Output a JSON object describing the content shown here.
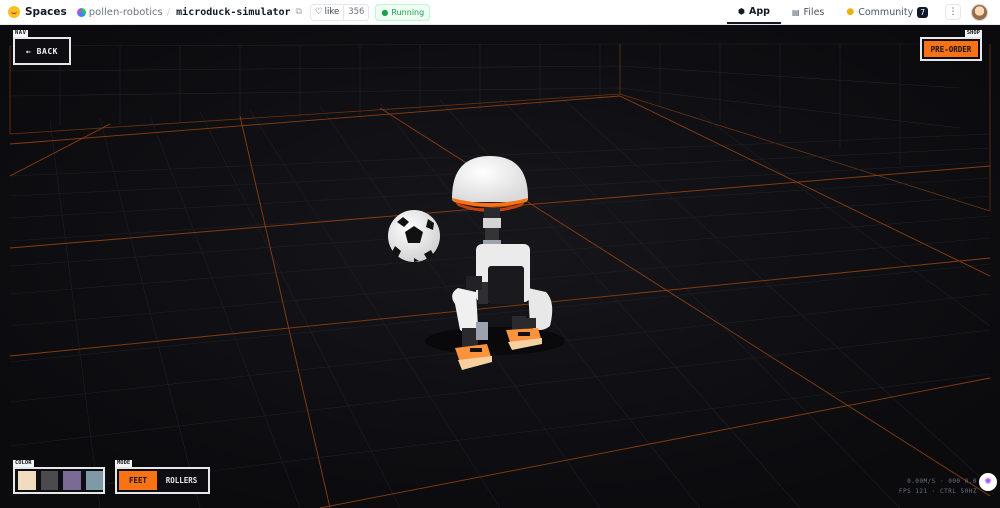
{
  "topbar": {
    "brand": "Spaces",
    "owner": "pollen-robotics",
    "separator": "/",
    "repo": "microduck-simulator",
    "like_label": "like",
    "like_count": "356",
    "status": "Running",
    "tabs": [
      {
        "label": "App",
        "active": true
      },
      {
        "label": "Files",
        "active": false
      },
      {
        "label": "Community",
        "active": false,
        "count": "7"
      }
    ]
  },
  "hud": {
    "nav_tag": "NAV",
    "back_label": "← BACK",
    "shop_tag": "SHOP",
    "preorder_label": "PRE-ORDER",
    "color_tag": "COLOR",
    "color_swatches": [
      "#f1dcc0",
      "#4b4b4f",
      "#7a6a96",
      "#7d9aa6"
    ],
    "mode_tag": "MODE",
    "mode_options": [
      "FEET",
      "ROLLERS"
    ],
    "selected_mode": "FEET",
    "stats_line1": "0.00M/S · 000 0.0",
    "stats_line2": "FPS 121 · CTRL 50HZ"
  },
  "colors": {
    "accent": "#f97316",
    "grid_major": "#a34a12",
    "grid_minor": "#26262c",
    "background": "#0e0e12"
  }
}
